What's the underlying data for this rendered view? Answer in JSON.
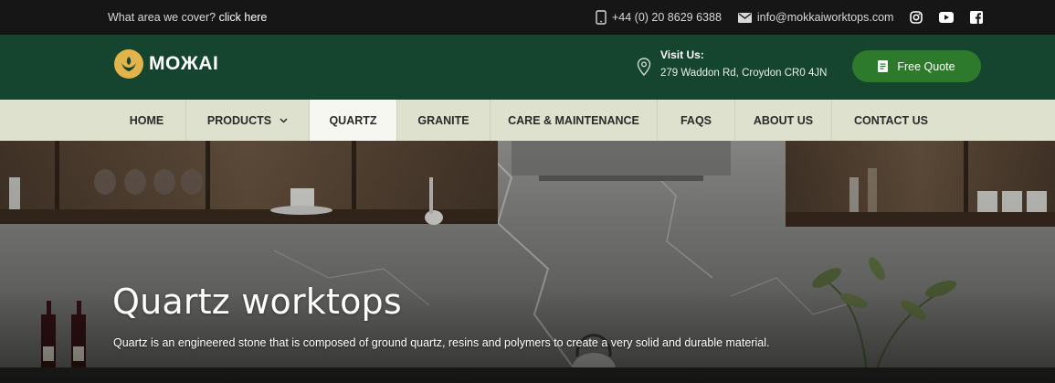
{
  "topbar": {
    "coverage_text": "What area we cover?",
    "coverage_link": "click here",
    "phone": "+44 (0) 20 8629 6388",
    "email": "info@mokkaiworktops.com",
    "icons": [
      "phone-icon",
      "mail-icon",
      "instagram-icon",
      "youtube-icon",
      "facebook-icon"
    ]
  },
  "header": {
    "logo_text": "MOЖAI",
    "visit_label": "Visit Us:",
    "address": "279 Waddon Rd, Croydon CR0 4JN",
    "quote_button": "Free Quote"
  },
  "nav": {
    "items": [
      {
        "label": "HOME"
      },
      {
        "label": "PRODUCTS"
      },
      {
        "label": "QUARTZ"
      },
      {
        "label": "GRANITE"
      },
      {
        "label": "CARE & MAINTENANCE"
      },
      {
        "label": "FAQS"
      },
      {
        "label": "ABOUT US"
      },
      {
        "label": "CONTACT US"
      }
    ],
    "active": "QUARTZ"
  },
  "hero": {
    "title": "Quartz worktops",
    "subtitle": "Quartz is an engineered stone that is composed of ground quartz, resins and polymers to create a very solid and durable material."
  },
  "colors": {
    "topbar_bg": "#161616",
    "header_bg": "#16452f",
    "nav_bg": "#dfe1cf",
    "button_green": "#2e7a2d",
    "logo_gold": "#e2b44a"
  }
}
